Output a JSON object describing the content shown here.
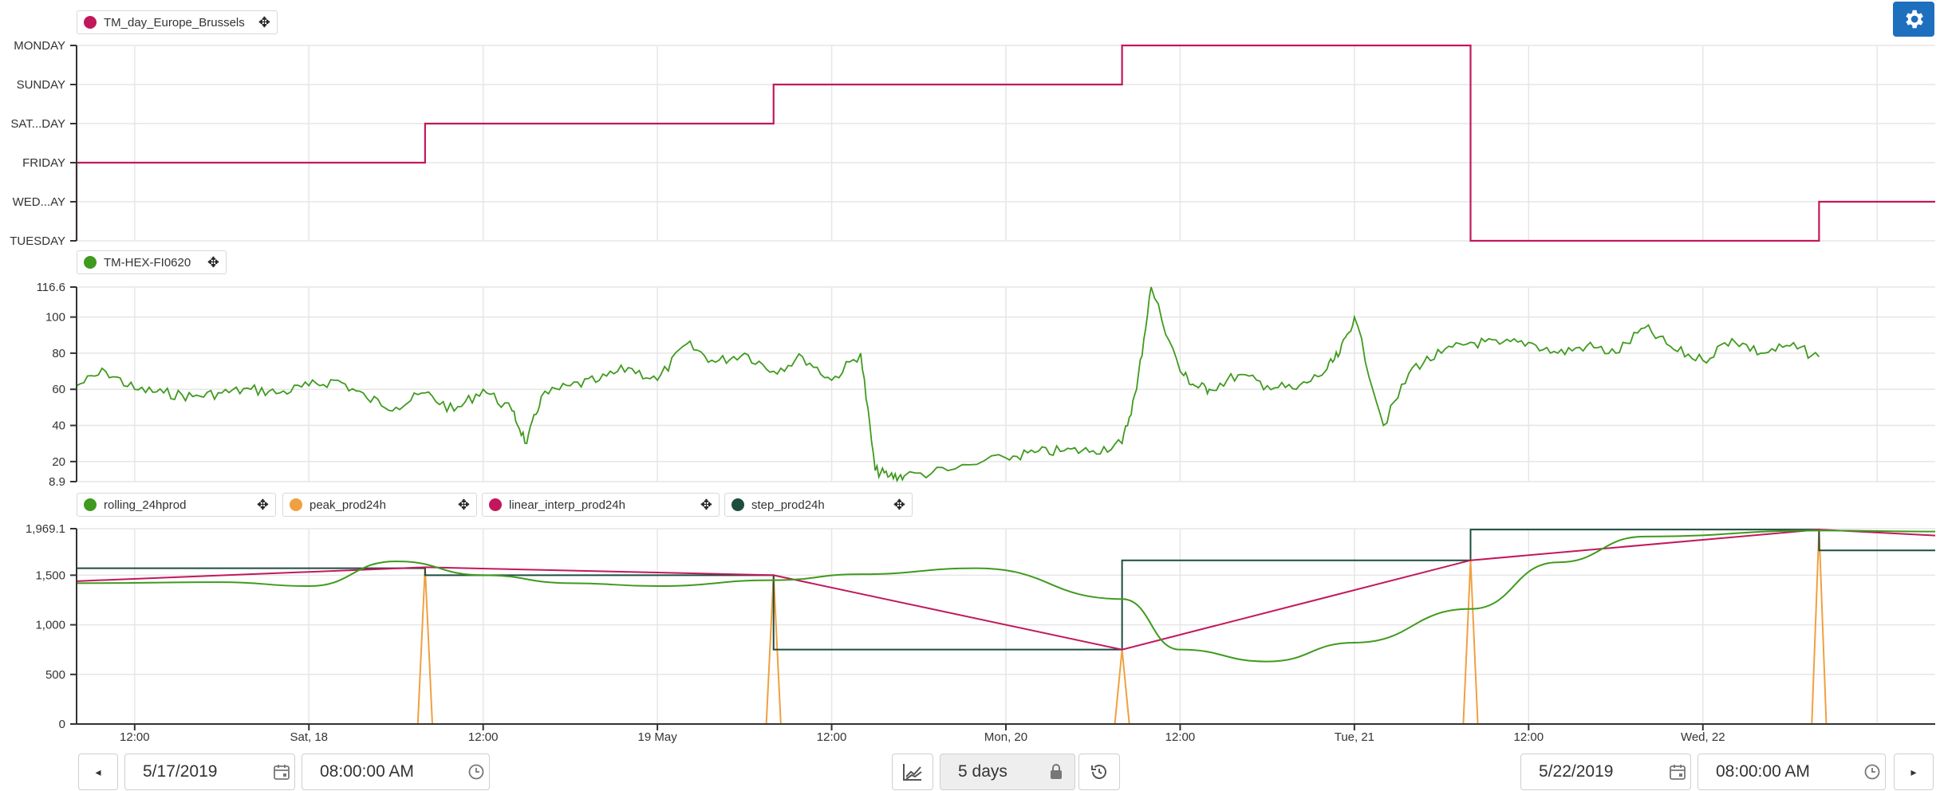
{
  "colors": {
    "panel1_line": "#c2185b",
    "panel2_line": "#3f9a1e",
    "rolling": "#3f9a1e",
    "peak": "#f0a040",
    "linear": "#c2185b",
    "step": "#1d4d3f",
    "accent_button": "#1f6fbf"
  },
  "panel1": {
    "legend": "TM_day_Europe_Brussels",
    "ticks": [
      "MONDAY",
      "SUNDAY",
      "SAT...DAY",
      "FRIDAY",
      "WED...AY",
      "TUESDAY"
    ]
  },
  "panel2": {
    "legend": "TM-HEX-FI0620",
    "ticks": [
      "116.6",
      "100",
      "80",
      "60",
      "40",
      "20",
      "8.9"
    ]
  },
  "panel3": {
    "legends": [
      "rolling_24hprod",
      "peak_prod24h",
      "linear_interp_prod24h",
      "step_prod24h"
    ],
    "ticks": [
      "1,969.1",
      "1,500",
      "1,000",
      "500",
      "0"
    ]
  },
  "xaxis": {
    "labels": [
      "12:00",
      "Sat, 18",
      "12:00",
      "19 May",
      "12:00",
      "Mon, 20",
      "12:00",
      "Tue, 21",
      "12:00",
      "Wed, 22"
    ]
  },
  "controls": {
    "start_date": "5/17/2019",
    "start_time": "08:00:00 AM",
    "range": "5 days",
    "end_date": "5/22/2019",
    "end_time": "08:00:00 AM",
    "icons": [
      "settings-gear-icon",
      "prev-arrow-icon",
      "calendar-icon",
      "clock-icon",
      "chart-type-icon",
      "lock-icon",
      "history-icon",
      "next-arrow-icon"
    ]
  },
  "chart_data": [
    {
      "type": "line",
      "step": true,
      "categories": [
        "TUESDAY",
        "WED...AY",
        "FRIDAY",
        "SAT...DAY",
        "SUNDAY",
        "MONDAY"
      ],
      "x_range": [
        "2019-05-17 08:00",
        "2019-05-22 08:00"
      ],
      "series": [
        {
          "name": "TM_day_Europe_Brussels",
          "x": [
            "2019-05-17 08:00",
            "2019-05-18 08:00",
            "2019-05-19 08:00",
            "2019-05-20 08:00",
            "2019-05-21 08:00",
            "2019-05-22 08:00"
          ],
          "values": [
            "FRIDAY",
            "SAT...DAY",
            "SUNDAY",
            "MONDAY",
            "TUESDAY",
            "WED...AY"
          ]
        }
      ]
    },
    {
      "type": "line",
      "ylim": [
        8.9,
        116.6
      ],
      "series": [
        {
          "name": "TM-HEX-FI0620",
          "x": [
            "2019-05-17 08:00",
            "2019-05-17 10:00",
            "2019-05-17 12:00",
            "2019-05-17 14:00",
            "2019-05-17 16:00",
            "2019-05-17 18:00",
            "2019-05-17 20:00",
            "2019-05-17 22:00",
            "2019-05-18 00:00",
            "2019-05-18 02:00",
            "2019-05-18 04:00",
            "2019-05-18 06:00",
            "2019-05-18 08:00",
            "2019-05-18 10:00",
            "2019-05-18 12:00",
            "2019-05-18 14:00",
            "2019-05-18 15:00",
            "2019-05-18 16:00",
            "2019-05-18 18:00",
            "2019-05-18 20:00",
            "2019-05-18 22:00",
            "2019-05-19 00:00",
            "2019-05-19 02:00",
            "2019-05-19 04:00",
            "2019-05-19 06:00",
            "2019-05-19 08:00",
            "2019-05-19 10:00",
            "2019-05-19 12:00",
            "2019-05-19 14:00",
            "2019-05-19 15:00",
            "2019-05-19 16:00",
            "2019-05-19 17:00",
            "2019-05-19 20:00",
            "2019-05-20 00:00",
            "2019-05-20 02:00",
            "2019-05-20 04:00",
            "2019-05-20 06:00",
            "2019-05-20 08:00",
            "2019-05-20 09:00",
            "2019-05-20 10:00",
            "2019-05-20 12:00",
            "2019-05-20 13:00",
            "2019-05-20 14:00",
            "2019-05-20 16:00",
            "2019-05-20 18:00",
            "2019-05-20 20:00",
            "2019-05-20 22:00",
            "2019-05-20 23:00",
            "2019-05-21 00:00",
            "2019-05-21 02:00",
            "2019-05-21 04:00",
            "2019-05-21 06:00",
            "2019-05-21 08:00",
            "2019-05-21 10:00",
            "2019-05-21 12:00",
            "2019-05-21 14:00",
            "2019-05-21 16:00",
            "2019-05-21 18:00",
            "2019-05-21 20:00",
            "2019-05-21 22:00",
            "2019-05-22 00:00",
            "2019-05-22 02:00",
            "2019-05-22 04:00",
            "2019-05-22 06:00",
            "2019-05-22 08:00"
          ],
          "values": [
            62,
            70,
            60,
            58,
            56,
            58,
            60,
            58,
            62,
            65,
            55,
            50,
            58,
            48,
            60,
            48,
            30,
            56,
            62,
            65,
            72,
            65,
            85,
            75,
            80,
            70,
            78,
            65,
            80,
            15,
            12,
            12,
            15,
            22,
            25,
            26,
            26,
            30,
            60,
            116.6,
            70,
            62,
            60,
            68,
            62,
            60,
            70,
            80,
            100,
            40,
            72,
            80,
            86,
            85,
            86,
            80,
            84,
            80,
            94,
            82,
            76,
            88,
            80,
            84,
            78
          ]
        }
      ]
    },
    {
      "type": "line",
      "ylim": [
        0,
        1969.1
      ],
      "series": [
        {
          "name": "rolling_24hprod",
          "x": [
            "2019-05-17 08:00",
            "2019-05-17 18:00",
            "2019-05-18 00:00",
            "2019-05-18 06:00",
            "2019-05-18 12:00",
            "2019-05-18 18:00",
            "2019-05-19 00:00",
            "2019-05-19 08:00",
            "2019-05-19 14:00",
            "2019-05-19 22:00",
            "2019-05-20 08:00",
            "2019-05-20 12:00",
            "2019-05-20 18:00",
            "2019-05-21 00:00",
            "2019-05-21 08:00",
            "2019-05-21 14:00",
            "2019-05-21 20:00",
            "2019-05-22 08:00",
            "2019-05-22 16:00"
          ],
          "values": [
            1420,
            1430,
            1390,
            1640,
            1500,
            1420,
            1390,
            1450,
            1510,
            1570,
            1260,
            750,
            630,
            820,
            1160,
            1630,
            1890,
            1950,
            1940
          ]
        },
        {
          "name": "peak_prod24h",
          "x": [
            "2019-05-17 08:00",
            "2019-05-18 07:30",
            "2019-05-18 08:00",
            "2019-05-18 08:30",
            "2019-05-19 07:30",
            "2019-05-19 08:00",
            "2019-05-19 08:30",
            "2019-05-20 07:30",
            "2019-05-20 08:00",
            "2019-05-20 08:30",
            "2019-05-21 07:30",
            "2019-05-21 08:00",
            "2019-05-21 08:30",
            "2019-05-22 07:30",
            "2019-05-22 08:00",
            "2019-05-22 08:30",
            "2019-05-22 16:00"
          ],
          "values": [
            0,
            0,
            1580,
            0,
            0,
            1510,
            0,
            0,
            750,
            0,
            0,
            1650,
            0,
            0,
            1960,
            0,
            0
          ]
        },
        {
          "name": "linear_interp_prod24h",
          "x": [
            "2019-05-17 08:00",
            "2019-05-18 08:00",
            "2019-05-19 08:00",
            "2019-05-20 08:00",
            "2019-05-21 08:00",
            "2019-05-22 08:00",
            "2019-05-22 16:00"
          ],
          "values": [
            1440,
            1580,
            1500,
            750,
            1650,
            1960,
            1900
          ]
        },
        {
          "name": "step_prod24h",
          "x": [
            "2019-05-17 08:00",
            "2019-05-18 08:00",
            "2019-05-19 08:00",
            "2019-05-20 08:00",
            "2019-05-21 08:00",
            "2019-05-22 08:00",
            "2019-05-22 16:00"
          ],
          "values": [
            1570,
            1500,
            750,
            1650,
            1960,
            1750,
            1750
          ],
          "step": true
        }
      ]
    }
  ]
}
